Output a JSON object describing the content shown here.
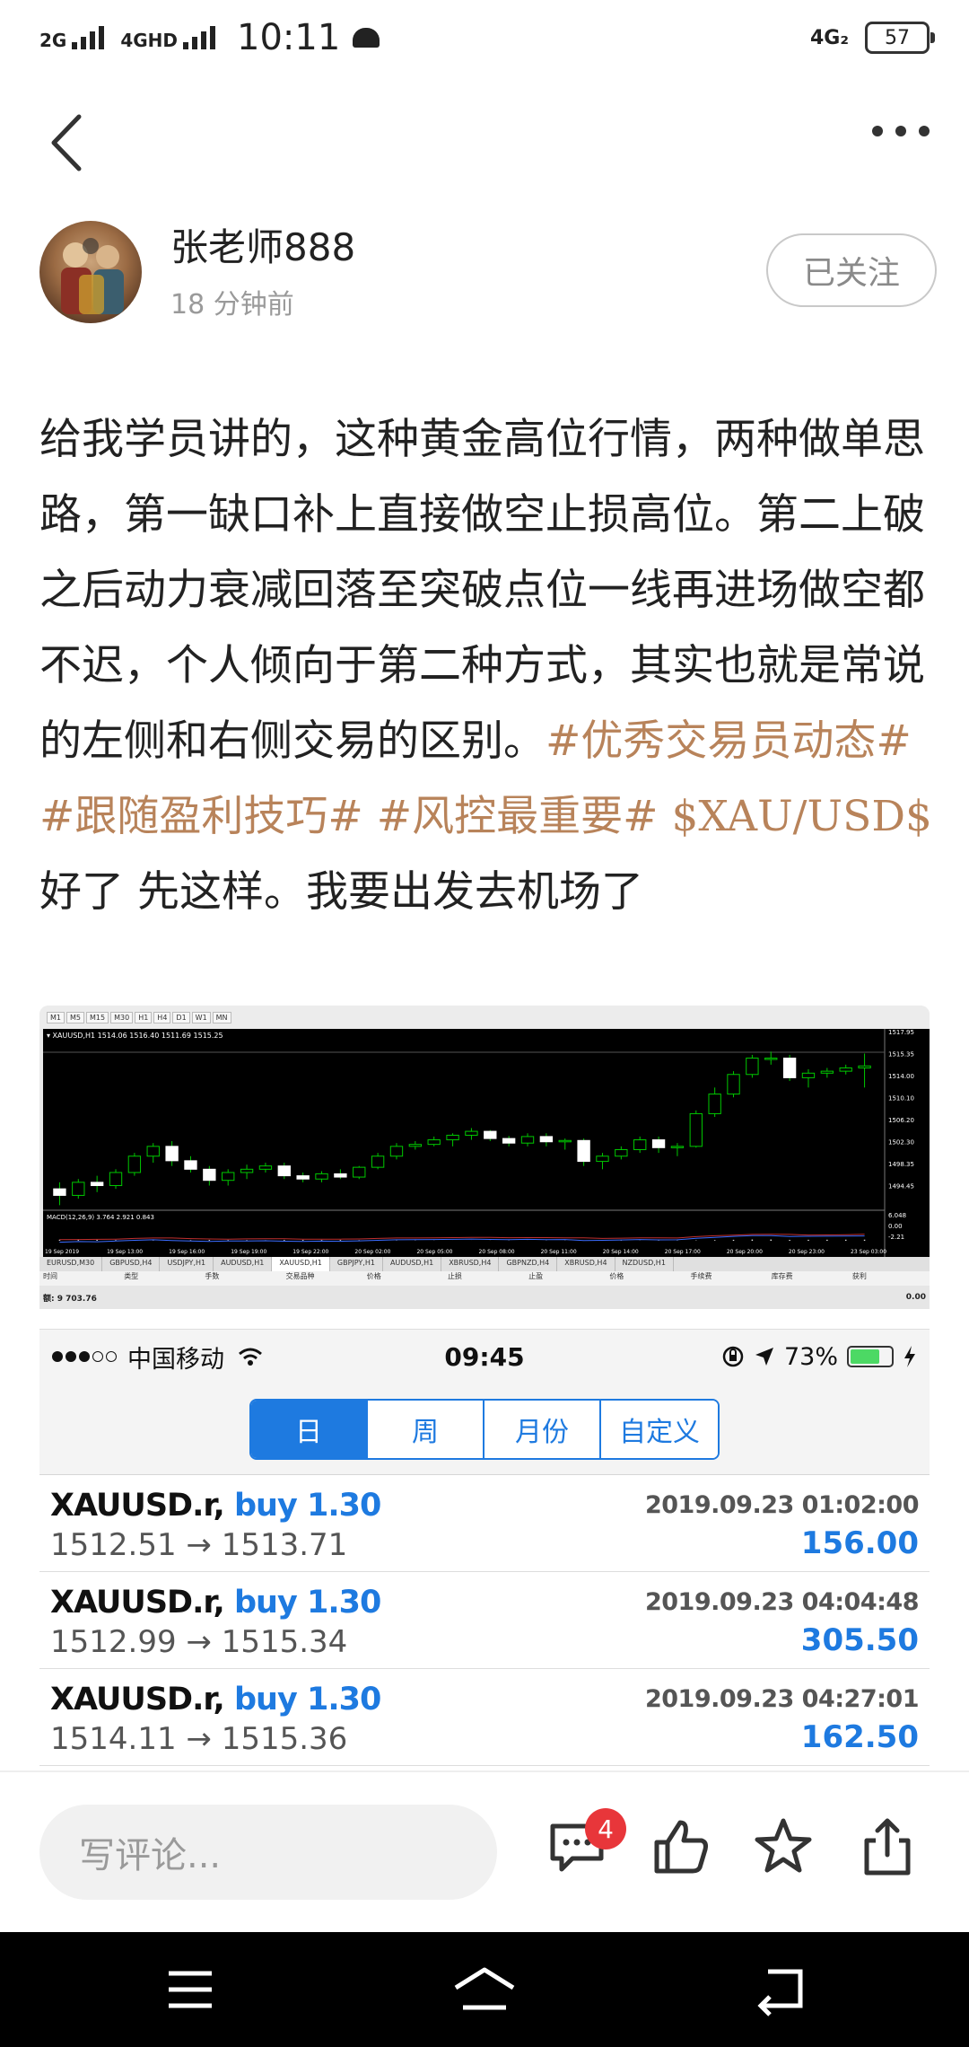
{
  "status_bar": {
    "sim1": "2G",
    "sim2": "4GHD",
    "time": "10:11",
    "right_net": "4G₂",
    "battery": "57"
  },
  "author": {
    "name": "张老师888",
    "time_ago": "18 分钟前",
    "follow_label": "已关注"
  },
  "post": {
    "text_main": "给我学员讲的，这种黄金高位行情，两种做单思路，第一缺口补上直接做空止损高位。第二上破之后动力衰减回落至突破点位一线再进场做空都不迟，个人倾向于第二种方式，其实也就是常说的左侧和右侧交易的区别。",
    "tags": [
      "#优秀交易员动态#",
      "#跟随盈利技巧#",
      "#风控最重要#"
    ],
    "symbol": "$XAU/USD$",
    "text_tail": " 好了 先这样。我要出发去机场了"
  },
  "mt4": {
    "timeframes": [
      "M1",
      "M5",
      "M15",
      "M30",
      "H1",
      "H4",
      "D1",
      "W1",
      "MN"
    ],
    "chart_header": "▾ XAUUSD,H1  1514.06 1516.40 1511.69 1515.25",
    "macd_label": "MACD(12,26,9) 3.764 2.921 0.843",
    "price_ticks": [
      "1517.95",
      "1515.35",
      "1514.00",
      "1510.10",
      "1506.20",
      "1502.30",
      "1498.35",
      "1494.45"
    ],
    "macd_ticks": [
      "6.048",
      "0.00",
      "-2.21"
    ],
    "time_ticks": [
      "19 Sep 2019",
      "19 Sep 13:00",
      "19 Sep 16:00",
      "19 Sep 19:00",
      "19 Sep 22:00",
      "20 Sep 02:00",
      "20 Sep 05:00",
      "20 Sep 08:00",
      "20 Sep 11:00",
      "20 Sep 14:00",
      "20 Sep 17:00",
      "20 Sep 20:00",
      "20 Sep 23:00",
      "23 Sep 03:00"
    ],
    "symbol_tabs": [
      "EURUSD,M30",
      "GBPUSD,H4",
      "USDJPY,H1",
      "AUDUSD,H1",
      "XAUUSD,H1",
      "GBPJPY,H1",
      "AUDUSD,H1",
      "XBRUSD,H4",
      "GBPNZD,H4",
      "XBRUSD,H4",
      "NZDUSD,H1"
    ],
    "active_tab": "XAUUSD,H1",
    "terminal_headers": [
      "时间",
      "类型",
      "手数",
      "交易品种",
      "价格",
      "止损",
      "止盈",
      "价格",
      "手续费",
      "库存费",
      "获利"
    ],
    "balance_label": "额: 9 703.76",
    "balance_profit": "0.00",
    "candles": [
      [
        1496.5,
        1497.5,
        1494.0,
        1495.5
      ],
      [
        1495.5,
        1498.0,
        1495.0,
        1497.5
      ],
      [
        1497.5,
        1498.5,
        1496.0,
        1497.0
      ],
      [
        1497.0,
        1499.5,
        1496.5,
        1499.0
      ],
      [
        1499.0,
        1502.0,
        1498.5,
        1501.5
      ],
      [
        1501.5,
        1503.5,
        1500.5,
        1503.0
      ],
      [
        1503.0,
        1503.8,
        1500.0,
        1500.8
      ],
      [
        1500.8,
        1501.5,
        1499.0,
        1499.5
      ],
      [
        1499.5,
        1500.0,
        1497.0,
        1497.8
      ],
      [
        1497.8,
        1499.5,
        1497.0,
        1499.0
      ],
      [
        1499.0,
        1500.2,
        1498.0,
        1499.5
      ],
      [
        1499.5,
        1500.5,
        1499.0,
        1500.0
      ],
      [
        1500.0,
        1500.5,
        1498.0,
        1498.5
      ],
      [
        1498.5,
        1499.0,
        1497.5,
        1498.0
      ],
      [
        1498.0,
        1499.2,
        1497.5,
        1498.8
      ],
      [
        1498.8,
        1499.5,
        1498.0,
        1498.3
      ],
      [
        1498.3,
        1500.0,
        1498.0,
        1499.8
      ],
      [
        1499.8,
        1502.0,
        1499.5,
        1501.5
      ],
      [
        1501.5,
        1503.5,
        1501.0,
        1503.0
      ],
      [
        1503.0,
        1503.8,
        1502.5,
        1503.3
      ],
      [
        1503.3,
        1504.5,
        1503.0,
        1504.0
      ],
      [
        1504.0,
        1505.0,
        1503.0,
        1504.7
      ],
      [
        1504.7,
        1505.8,
        1504.0,
        1505.3
      ],
      [
        1505.3,
        1505.5,
        1503.8,
        1504.2
      ],
      [
        1504.2,
        1504.6,
        1503.0,
        1503.5
      ],
      [
        1503.5,
        1505.0,
        1503.0,
        1504.5
      ],
      [
        1504.5,
        1505.0,
        1503.0,
        1503.7
      ],
      [
        1503.7,
        1504.2,
        1502.5,
        1503.9
      ],
      [
        1503.9,
        1504.2,
        1500.0,
        1500.7
      ],
      [
        1500.7,
        1502.0,
        1499.5,
        1501.5
      ],
      [
        1501.5,
        1503.0,
        1501.0,
        1502.5
      ],
      [
        1502.5,
        1504.5,
        1502.0,
        1504.0
      ],
      [
        1504.0,
        1504.5,
        1502.0,
        1502.8
      ],
      [
        1502.8,
        1503.5,
        1501.5,
        1503.0
      ],
      [
        1503.0,
        1508.5,
        1502.8,
        1508.0
      ],
      [
        1508.0,
        1512.0,
        1507.5,
        1511.0
      ],
      [
        1511.0,
        1514.5,
        1510.5,
        1514.0
      ],
      [
        1514.0,
        1517.0,
        1513.5,
        1516.5
      ],
      [
        1516.5,
        1517.5,
        1515.5,
        1516.5
      ],
      [
        1516.5,
        1517.0,
        1513.0,
        1513.5
      ],
      [
        1513.5,
        1514.8,
        1512.0,
        1514.2
      ],
      [
        1514.2,
        1515.0,
        1513.5,
        1514.5
      ],
      [
        1514.5,
        1515.5,
        1514.0,
        1515.0
      ],
      [
        1515.0,
        1517.2,
        1512.0,
        1515.3
      ]
    ]
  },
  "ios": {
    "carrier": "中国移动",
    "time": "09:45",
    "battery_pct": "73%",
    "battery_level": 0.73,
    "segments": [
      "日",
      "周",
      "月份",
      "自定义"
    ],
    "active_segment": 0,
    "trades": [
      {
        "symbol": "XAUUSD.r,",
        "direction": "buy 1.30",
        "datetime": "2019.09.23 01:02:00",
        "prices": "1512.51 → 1513.71",
        "profit": "156.00"
      },
      {
        "symbol": "XAUUSD.r,",
        "direction": "buy 1.30",
        "datetime": "2019.09.23 04:04:48",
        "prices": "1512.99 → 1515.34",
        "profit": "305.50"
      },
      {
        "symbol": "XAUUSD.r,",
        "direction": "buy 1.30",
        "datetime": "2019.09.23 04:27:01",
        "prices": "1514.11 → 1515.36",
        "profit": "162.50"
      }
    ]
  },
  "actions": {
    "comment_placeholder": "写评论...",
    "comment_count": "4"
  }
}
